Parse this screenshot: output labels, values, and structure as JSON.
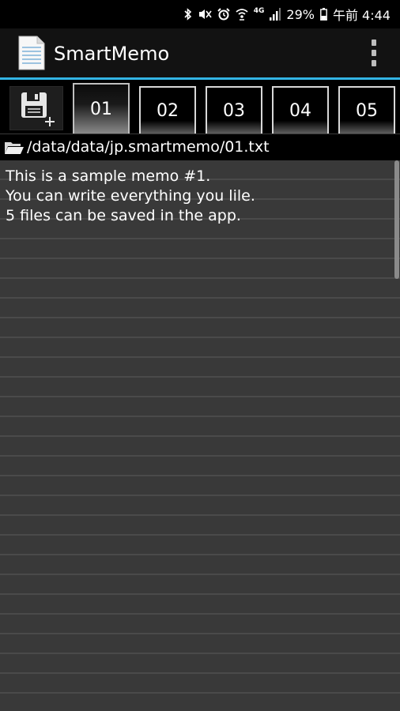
{
  "status_bar": {
    "icons": [
      "bluetooth-icon",
      "mute-icon",
      "alarm-icon",
      "wifi-icon",
      "4g-icon",
      "signal-icon",
      "battery-icon"
    ],
    "network_label": "4G",
    "battery": "29%",
    "time": "午前 4:44"
  },
  "app_bar": {
    "title": "SmartMemo",
    "menu_icon": "overflow-menu-icon"
  },
  "toolbar": {
    "save_icon": "save-new-icon",
    "tabs": [
      {
        "label": "01",
        "active": true
      },
      {
        "label": "02",
        "active": false
      },
      {
        "label": "03",
        "active": false
      },
      {
        "label": "04",
        "active": false
      },
      {
        "label": "05",
        "active": false
      }
    ]
  },
  "file": {
    "icon": "folder-open-icon",
    "path": "/data/data/jp.smartmemo/01.txt"
  },
  "memo": {
    "lines": [
      "This is a sample memo #1.",
      "You can write everything you lile.",
      "5 files can be saved in the app."
    ]
  },
  "colors": {
    "accent": "#33b5e5",
    "memo_background": "#393939",
    "action_bar": "#121212"
  }
}
